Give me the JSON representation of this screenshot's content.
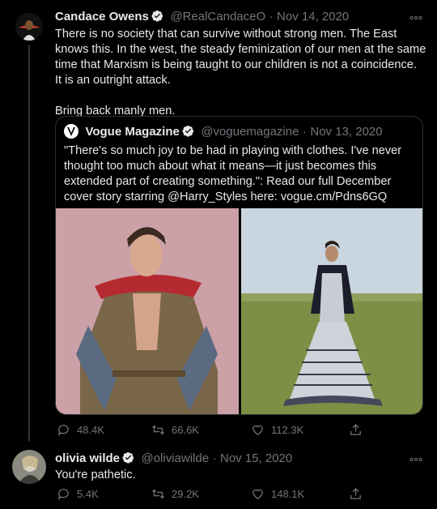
{
  "tweet1": {
    "display_name": "Candace Owens",
    "handle": "@RealCandaceO",
    "separator": "·",
    "date": "Nov 14, 2020",
    "paragraph1": "There is no society that can survive without strong men. The East knows this. In the west, the steady feminization of our men at the same time that Marxism is being taught to our children is not a coincidence.",
    "paragraph2": "It is an outright attack.",
    "paragraph3": "Bring back manly men.",
    "more_icon": "ellipsis-icon"
  },
  "quoted": {
    "display_name": "Vogue Magazine",
    "handle": "@voguemagazine",
    "separator": "·",
    "date": "Nov 13, 2020",
    "text": "\"There's so much joy to be had in playing with clothes. I've never thought too much about what it means—it just becomes this extended part of creating something.\": Read our full December cover story starring @Harry_Styles here: vogue.cm/Pdns6GQ"
  },
  "tweet1_actions": {
    "replies": "48.4K",
    "retweets": "66.6K",
    "likes": "112.3K"
  },
  "tweet2": {
    "display_name": "olivia wilde",
    "handle": "@oliviawilde",
    "separator": "·",
    "date": "Nov 15, 2020",
    "text": "You're pathetic."
  },
  "tweet2_actions": {
    "replies": "5.4K",
    "retweets": "29.2K",
    "likes": "148.1K"
  },
  "colors": {
    "background": "#000000",
    "text": "#e7e9ea",
    "muted": "#71767b",
    "verified": "#e7e9ea"
  }
}
